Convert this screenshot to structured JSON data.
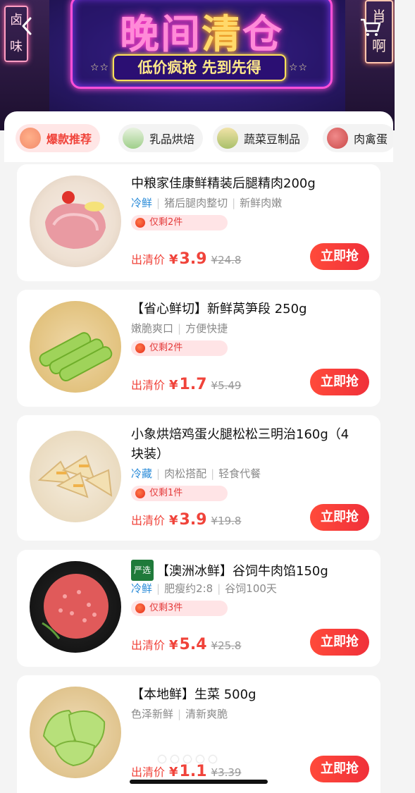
{
  "hero": {
    "title_part1": "晚间",
    "title_part2": "清",
    "title_part3": "仓",
    "subtitle": "低价疯抢 先到先得",
    "sign_left": "卤味",
    "sign_right": "肖啊"
  },
  "tabs": [
    {
      "label": "爆款推荐",
      "active": true
    },
    {
      "label": "乳品烘焙",
      "active": false
    },
    {
      "label": "蔬菜豆制品",
      "active": false
    },
    {
      "label": "肉禽蛋",
      "active": false
    }
  ],
  "products": [
    {
      "name": "中粮家佳康鲜精装后腿精肉200g",
      "tags": [
        "冷鲜",
        "猪后腿肉整切",
        "新鲜肉嫩"
      ],
      "stock": "仅剩2件",
      "price_label": "出清价",
      "price": "3.9",
      "original": "¥24.8",
      "buy": "立即抢"
    },
    {
      "name": "【省心鲜切】新鲜莴笋段 250g",
      "tags": [
        "嫩脆爽口",
        "方便快捷"
      ],
      "stock": "仅剩2件",
      "price_label": "出清价",
      "price": "1.7",
      "original": "¥5.49",
      "buy": "立即抢"
    },
    {
      "name_line1": "小象烘焙鸡蛋火腿松松三明治160g（4",
      "name_line2": "块装）",
      "tags": [
        "冷藏",
        "肉松搭配",
        "轻食代餐"
      ],
      "stock": "仅剩1件",
      "price_label": "出清价",
      "price": "3.9",
      "original": "¥19.8",
      "buy": "立即抢"
    },
    {
      "badge": "严选",
      "name": "【澳洲冰鲜】谷饲牛肉馅150g",
      "tags": [
        "冷鲜",
        "肥瘦约2:8",
        "谷饲100天"
      ],
      "stock": "仅剩3件",
      "price_label": "出清价",
      "price": "5.4",
      "original": "¥25.8",
      "buy": "立即抢"
    },
    {
      "name": "【本地鲜】生菜 500g",
      "tags": [
        "色泽新鲜",
        "清新爽脆"
      ],
      "price_label": "出清价",
      "price": "1.1",
      "original": "¥3.39",
      "buy": "立即抢"
    }
  ],
  "currency": "¥",
  "icons": [
    "back-icon",
    "cart-icon"
  ]
}
